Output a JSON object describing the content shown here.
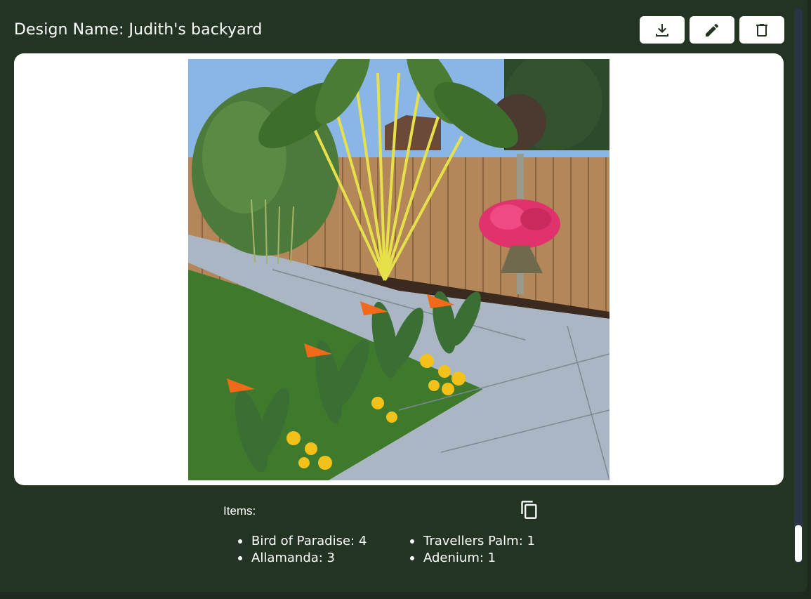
{
  "header": {
    "title": "Design Name: Judith's backyard"
  },
  "toolbar": {
    "download_icon": "download-icon",
    "edit_icon": "pencil-icon",
    "delete_icon": "trash-icon"
  },
  "items": {
    "label": "Items:",
    "copy_icon": "copy-icon",
    "entries": [
      "Bird of Paradise: 4",
      "Travellers Palm: 1",
      "Allamanda: 3",
      "Adenium: 1"
    ]
  },
  "colors": {
    "background": "#233422",
    "card": "#ffffff",
    "button": "#ffffff",
    "icon": "#233422"
  }
}
